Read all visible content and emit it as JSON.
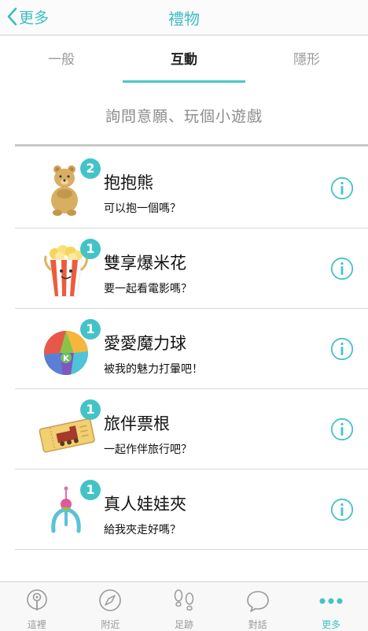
{
  "nav": {
    "back_label": "更多",
    "title": "禮物"
  },
  "tabs": [
    {
      "label": "一般"
    },
    {
      "label": "互動"
    },
    {
      "label": "隱形"
    }
  ],
  "subtitle": "詢問意願、玩個小遊戲",
  "gifts": [
    {
      "name": "抱抱熊",
      "desc": "可以抱一個嗎？",
      "count": "2",
      "icon": "bear-icon"
    },
    {
      "name": "雙享爆米花",
      "desc": "要一起看電影嗎？",
      "count": "1",
      "icon": "popcorn-icon"
    },
    {
      "name": "愛愛魔力球",
      "desc": "被我的魅力打暈吧！",
      "count": "1",
      "icon": "ball-icon"
    },
    {
      "name": "旅伴票根",
      "desc": "一起作伴旅行吧？",
      "count": "1",
      "icon": "ticket-icon"
    },
    {
      "name": "真人娃娃夾",
      "desc": "給我夾走好嗎？",
      "count": "1",
      "icon": "claw-icon"
    }
  ],
  "tabbar": [
    {
      "label": "這裡",
      "icon": "location-icon"
    },
    {
      "label": "附近",
      "icon": "compass-icon"
    },
    {
      "label": "足跡",
      "icon": "footprints-icon"
    },
    {
      "label": "對話",
      "icon": "chat-icon"
    },
    {
      "label": "更多",
      "icon": "more-icon"
    }
  ],
  "colors": {
    "accent": "#44c3c7",
    "text": "#111111",
    "muted": "#999999"
  },
  "active_tab_index": 1,
  "active_tabbar_index": 4
}
